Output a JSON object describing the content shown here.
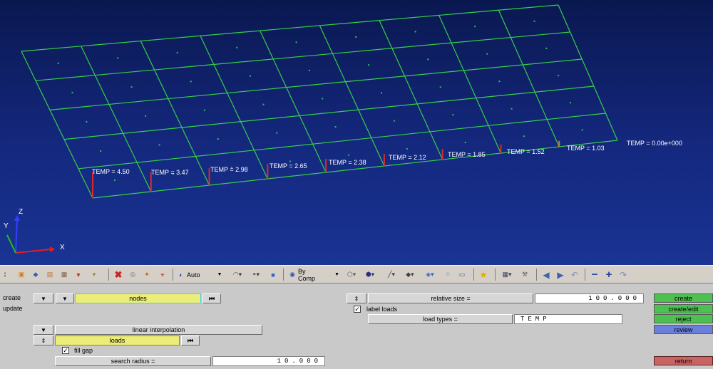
{
  "viewport": {
    "temp_labels": [
      "TEMP = 4.50",
      "TEMP = 3.47",
      "TEMP = 2.98",
      "TEMP = 2.65",
      "TEMP = 2.38",
      "TEMP = 2.12",
      "TEMP = 1.85",
      "TEMP = 1.52",
      "TEMP = 1.03",
      "TEMP = 0.00e+000"
    ],
    "axis": {
      "z": "Z",
      "y": "Y",
      "x": "X"
    }
  },
  "toolbar": {
    "auto_label": "Auto",
    "bycomp_label": "By Comp"
  },
  "panel": {
    "create_radio": "create",
    "update_radio": "update",
    "nodes_label": "nodes",
    "linear_interp_label": "linear interpolation",
    "loads_label": "loads",
    "fill_gap_label": "fill gap",
    "fill_gap_checked": "✓",
    "search_radius_label": "search radius =",
    "search_radius_value": "10.000",
    "relative_size_label": "relative size =",
    "relative_size_value": "100.000",
    "label_loads_label": "label loads",
    "label_loads_checked": "✓",
    "load_types_label": "load types =",
    "load_types_value": "TEMP",
    "actions": {
      "create": "create",
      "create_edit": "create/edit",
      "reject": "reject",
      "review": "review",
      "return": "return"
    },
    "colors": {
      "green": "#4cc050",
      "blue": "#6a7fdc",
      "red": "#c86464",
      "yellow": "#ecec78"
    }
  }
}
